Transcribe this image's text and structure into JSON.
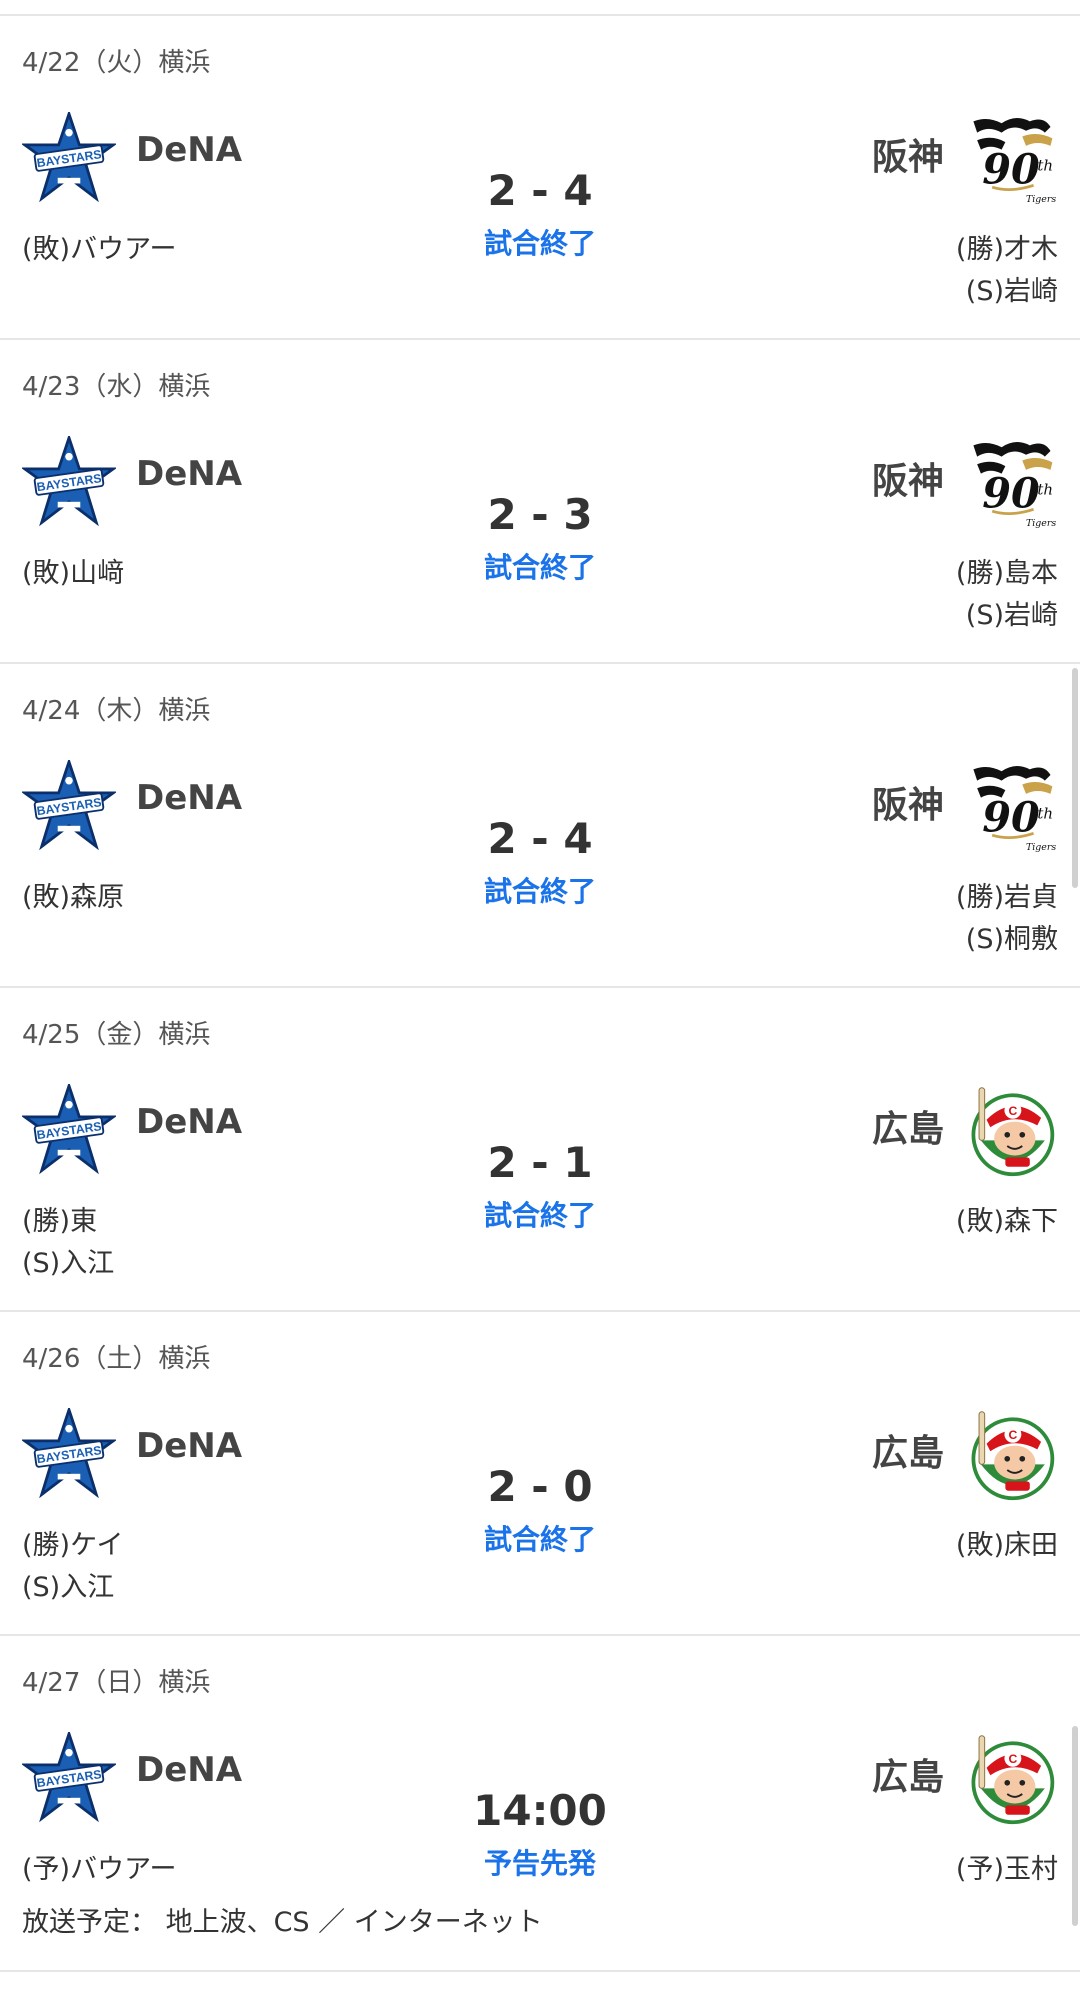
{
  "colors": {
    "accent": "#1a73e8",
    "divider": "#e6e6e6",
    "text": "#333333"
  },
  "games": [
    {
      "date": "4/22（火）横浜",
      "home": {
        "name": "DeNA",
        "logo": "baystars-logo",
        "pitchers": [
          "(敗)バウアー"
        ]
      },
      "away": {
        "name": "阪神",
        "logo": "tigers-90th-logo",
        "pitchers": [
          "(勝)才木",
          "(S)岩崎"
        ]
      },
      "score": "2 - 4",
      "status": "試合終了"
    },
    {
      "date": "4/23（水）横浜",
      "home": {
        "name": "DeNA",
        "logo": "baystars-logo",
        "pitchers": [
          "(敗)山﨑"
        ]
      },
      "away": {
        "name": "阪神",
        "logo": "tigers-90th-logo",
        "pitchers": [
          "(勝)島本",
          "(S)岩崎"
        ]
      },
      "score": "2 - 3",
      "status": "試合終了"
    },
    {
      "date": "4/24（木）横浜",
      "home": {
        "name": "DeNA",
        "logo": "baystars-logo",
        "pitchers": [
          "(敗)森原"
        ]
      },
      "away": {
        "name": "阪神",
        "logo": "tigers-90th-logo",
        "pitchers": [
          "(勝)岩貞",
          "(S)桐敷"
        ]
      },
      "score": "2 - 4",
      "status": "試合終了"
    },
    {
      "date": "4/25（金）横浜",
      "home": {
        "name": "DeNA",
        "logo": "baystars-logo",
        "pitchers": [
          "(勝)東",
          "(S)入江"
        ]
      },
      "away": {
        "name": "広島",
        "logo": "carp-logo",
        "pitchers": [
          "(敗)森下"
        ]
      },
      "score": "2 - 1",
      "status": "試合終了"
    },
    {
      "date": "4/26（土）横浜",
      "home": {
        "name": "DeNA",
        "logo": "baystars-logo",
        "pitchers": [
          "(勝)ケイ",
          "(S)入江"
        ]
      },
      "away": {
        "name": "広島",
        "logo": "carp-logo",
        "pitchers": [
          "(敗)床田"
        ]
      },
      "score": "2 - 0",
      "status": "試合終了"
    },
    {
      "date": "4/27（日）横浜",
      "home": {
        "name": "DeNA",
        "logo": "baystars-logo",
        "pitchers": [
          "(予)バウアー"
        ]
      },
      "away": {
        "name": "広島",
        "logo": "carp-logo",
        "pitchers": [
          "(予)玉村"
        ]
      },
      "score": "14:00",
      "status": "予告先発",
      "broadcast": "放送予定： 地上波、CS ／ インターネット"
    }
  ]
}
